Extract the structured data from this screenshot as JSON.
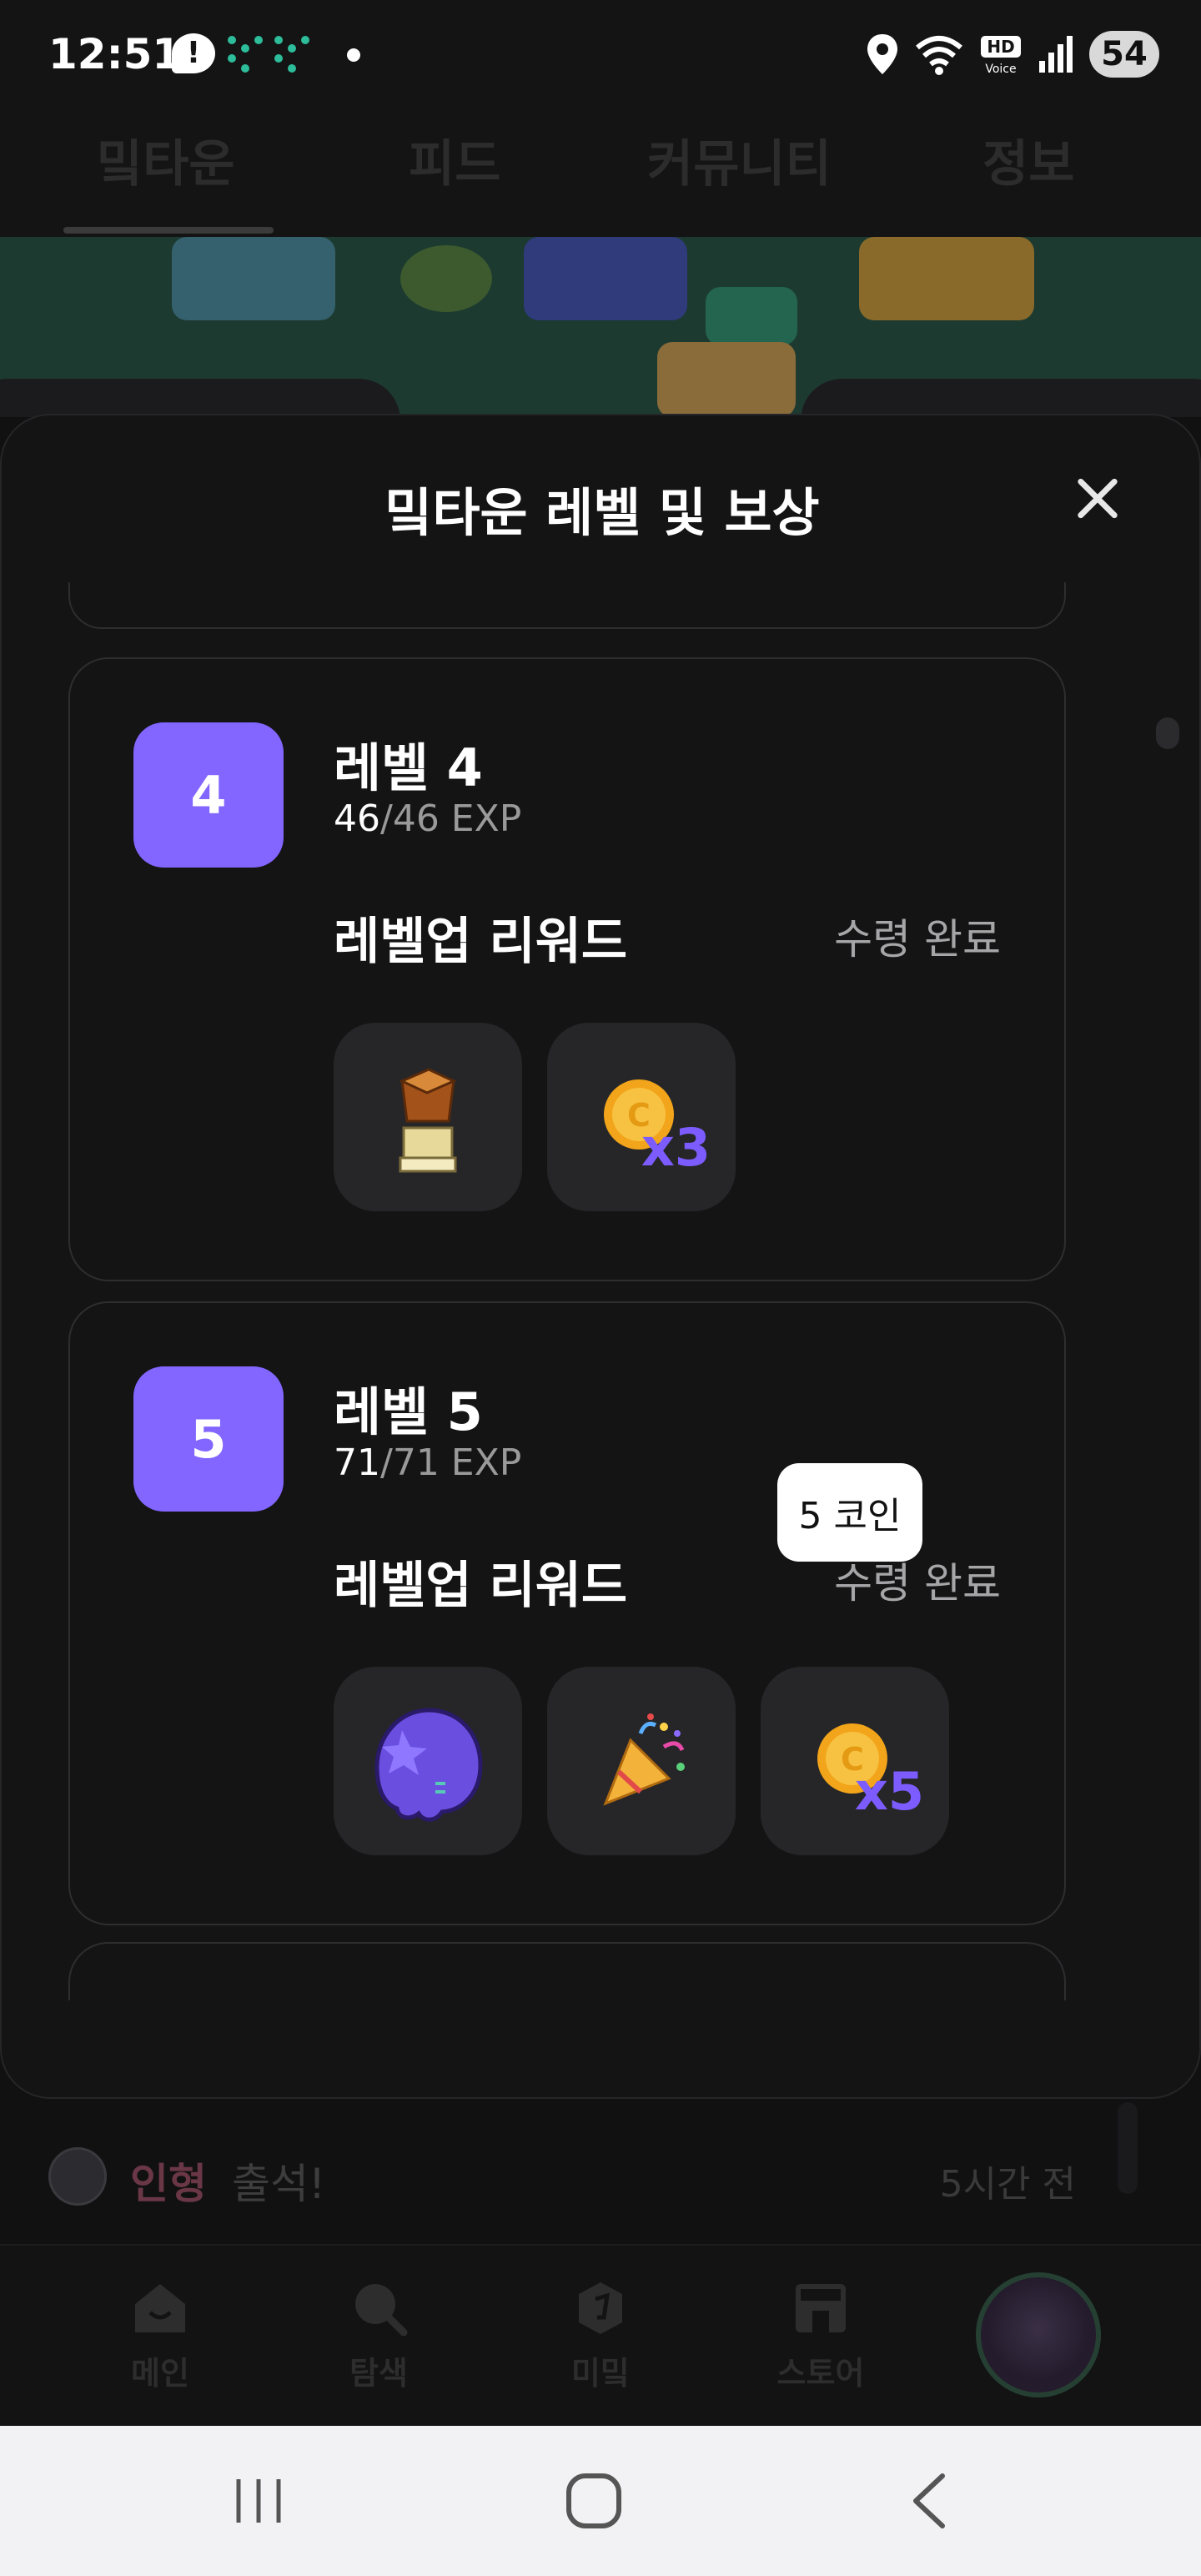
{
  "status_bar": {
    "time": "12:51",
    "notification_glyph": "!",
    "battery": "54",
    "icons": [
      "location-icon",
      "wifi-icon",
      "hd-voice-icon",
      "signal-icon",
      "battery-icon"
    ]
  },
  "top_tabs": [
    {
      "label": "밐타운",
      "selected": true
    },
    {
      "label": "피드",
      "selected": false
    },
    {
      "label": "커뮤니티",
      "selected": false
    },
    {
      "label": "정보",
      "selected": false
    }
  ],
  "modal": {
    "title": "밐타운 레벨 및 보상",
    "levels": [
      {
        "badge": "4",
        "title": "레벨 4",
        "exp_current": "46",
        "exp_rest": "/46 EXP",
        "reward_heading": "레벨업 리워드",
        "status": "수령 완료",
        "rewards": [
          {
            "icon": "trophy-box-icon"
          },
          {
            "icon": "coin-icon",
            "quantity": "x3"
          }
        ]
      },
      {
        "badge": "5",
        "title": "레벨 5",
        "exp_current": "71",
        "exp_rest": "/71 EXP",
        "reward_heading": "레벨업 리워드",
        "status": "수령 완료",
        "rewards": [
          {
            "icon": "purple-ghost-icon"
          },
          {
            "icon": "party-popper-icon"
          },
          {
            "icon": "coin-icon",
            "quantity": "x5"
          }
        ]
      }
    ],
    "tooltip": "5 코인"
  },
  "chat": {
    "name": "인형",
    "text": "출석!",
    "time": "5시간 전"
  },
  "bottom_nav": [
    {
      "label": "메인",
      "icon": "home-icon"
    },
    {
      "label": "탐색",
      "icon": "search-icon"
    },
    {
      "label": "미밐",
      "icon": "mimic-icon"
    },
    {
      "label": "스토어",
      "icon": "store-icon"
    }
  ],
  "colors": {
    "accent": "#8266ff",
    "coin_text": "#7c5cff",
    "background": "#141415"
  }
}
